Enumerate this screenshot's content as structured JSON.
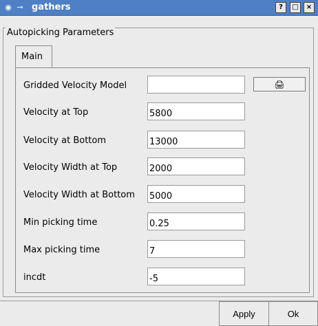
{
  "window": {
    "title": "gathers",
    "buttons": {
      "help": "?",
      "maximize": "□",
      "close": "×"
    }
  },
  "group": {
    "title": "Autopicking Parameters"
  },
  "tabs": [
    {
      "label": "Main"
    }
  ],
  "fields": [
    {
      "label": "Gridded Velocity Model",
      "value": ""
    },
    {
      "label": "Velocity at Top",
      "value": "5800"
    },
    {
      "label": "Velocity at Bottom",
      "value": "13000"
    },
    {
      "label": "Velocity Width at Top",
      "value": "2000"
    },
    {
      "label": "Velocity Width at Bottom",
      "value": "5000"
    },
    {
      "label": "Min picking time",
      "value": "0.25"
    },
    {
      "label": "Max picking time",
      "value": "7"
    },
    {
      "label": "incdt",
      "value": "-5"
    }
  ],
  "browse_icon": "folder-open-icon",
  "actions": {
    "apply": "Apply",
    "ok": "Ok"
  }
}
